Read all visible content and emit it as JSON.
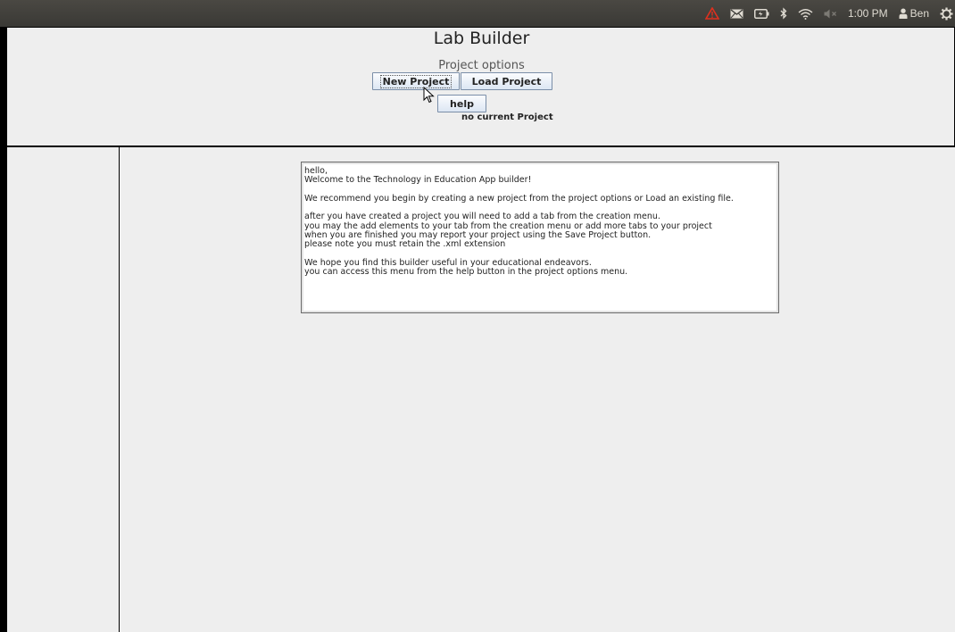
{
  "system_panel": {
    "clock": "1:00 PM",
    "user": "Ben",
    "icons": [
      "warning-icon",
      "mail-icon",
      "battery-icon",
      "bluetooth-icon",
      "wifi-icon",
      "volume-muted-icon",
      "user-icon",
      "gear-icon"
    ],
    "colors": {
      "panel": "#3c3b37",
      "warning": "#e0301e"
    }
  },
  "app": {
    "title": "Lab Builder",
    "options_label": "Project options",
    "buttons": {
      "new_project": "New Project",
      "load_project": "Load Project",
      "help": "help"
    },
    "status": "no current Project",
    "help_text": {
      "greeting": [
        "hello,",
        "Welcome to the Technology in Education App builder!"
      ],
      "recommend": [
        "We recommend you begin by creating a new project from the project options or Load an existing file."
      ],
      "instructions": [
        "after you have created a project you will need to add a tab from the creation menu.",
        "you may the add elements to your tab from the creation menu or add more tabs to your project",
        "when you are finished you may report your project using the Save Project button.",
        "please note you must retain the .xml extension"
      ],
      "closing": [
        "We hope you find this builder useful in your educational endeavors.",
        "you can access this menu from the help button in the project options menu."
      ]
    }
  }
}
